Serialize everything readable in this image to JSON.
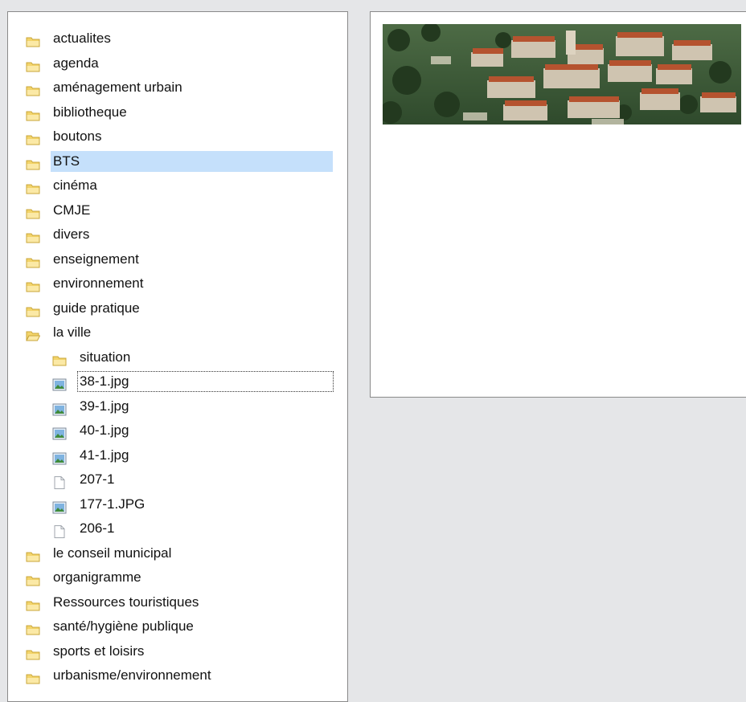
{
  "tree": {
    "items": [
      {
        "label": "actualites",
        "type": "folder"
      },
      {
        "label": "agenda",
        "type": "folder"
      },
      {
        "label": "aménagement urbain",
        "type": "folder"
      },
      {
        "label": "bibliotheque",
        "type": "folder"
      },
      {
        "label": "boutons",
        "type": "folder"
      },
      {
        "label": "BTS",
        "type": "folder",
        "selected": true
      },
      {
        "label": "cinéma",
        "type": "folder"
      },
      {
        "label": "CMJE",
        "type": "folder"
      },
      {
        "label": "divers",
        "type": "folder"
      },
      {
        "label": "enseignement",
        "type": "folder"
      },
      {
        "label": "environnement",
        "type": "folder"
      },
      {
        "label": "guide pratique",
        "type": "folder"
      },
      {
        "label": "la ville",
        "type": "folder-open",
        "expanded": true
      },
      {
        "label": "situation",
        "type": "folder"
      },
      {
        "label": "38-1.jpg",
        "type": "image",
        "focused": true
      },
      {
        "label": "39-1.jpg",
        "type": "image"
      },
      {
        "label": "40-1.jpg",
        "type": "image"
      },
      {
        "label": "41-1.jpg",
        "type": "image"
      },
      {
        "label": "207-1",
        "type": "file"
      },
      {
        "label": "177-1.JPG",
        "type": "image"
      },
      {
        "label": "206-1",
        "type": "file"
      },
      {
        "label": "le conseil municipal",
        "type": "folder"
      },
      {
        "label": "organigramme",
        "type": "folder"
      },
      {
        "label": "Ressources touristiques",
        "type": "folder"
      },
      {
        "label": "santé/hygiène publique",
        "type": "folder"
      },
      {
        "label": "sports et loisirs",
        "type": "folder"
      },
      {
        "label": "urbanisme/environnement",
        "type": "folder"
      }
    ]
  },
  "colors": {
    "background": "#e5e6e8",
    "selection": "#c5e0fb",
    "folder": "#f3d46a",
    "panel_border": "#8a8a8a"
  },
  "icons": {
    "folder": "folder-icon",
    "folder-open": "folder-open-icon",
    "image": "image-file-icon",
    "file": "blank-file-icon"
  }
}
